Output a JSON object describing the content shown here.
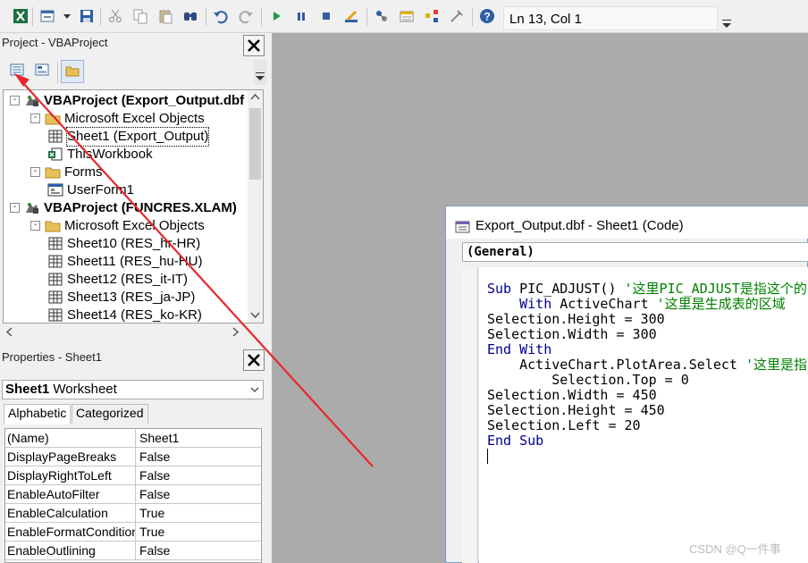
{
  "toolbar": {
    "position_text": "Ln 13, Col 1",
    "icons": [
      "excel-icon",
      "insert-userform-icon",
      "save-icon",
      "cut-icon",
      "copy-icon",
      "paste-icon",
      "find-icon",
      "undo-icon",
      "redo-icon",
      "run-icon",
      "break-icon",
      "reset-icon",
      "design-mode-icon",
      "project-explorer-icon",
      "properties-window-icon",
      "object-browser-icon",
      "toolbox-icon",
      "help-icon"
    ]
  },
  "project": {
    "title": "Project - VBAProject",
    "tree": [
      {
        "label": "VBAProject (Export_Output.dbf",
        "bold": true,
        "level": 0,
        "expander": "-",
        "icon": "vbaproject"
      },
      {
        "label": "Microsoft Excel Objects",
        "bold": false,
        "level": 1,
        "expander": "-",
        "icon": "folder"
      },
      {
        "label": "Sheet1 (Export_Output)",
        "bold": false,
        "level": 2,
        "expander": "",
        "icon": "sheet",
        "selected": true
      },
      {
        "label": "ThisWorkbook",
        "bold": false,
        "level": 2,
        "expander": "",
        "icon": "workbook"
      },
      {
        "label": "Forms",
        "bold": false,
        "level": 1,
        "expander": "-",
        "icon": "folder"
      },
      {
        "label": "UserForm1",
        "bold": false,
        "level": 2,
        "expander": "",
        "icon": "form"
      },
      {
        "label": "VBAProject (FUNCRES.XLAM)",
        "bold": true,
        "level": 0,
        "expander": "-",
        "icon": "vbaproject"
      },
      {
        "label": "Microsoft Excel Objects",
        "bold": false,
        "level": 1,
        "expander": "-",
        "icon": "folder"
      },
      {
        "label": "Sheet10 (RES_hr-HR)",
        "bold": false,
        "level": 2,
        "expander": "",
        "icon": "sheet"
      },
      {
        "label": "Sheet11 (RES_hu-HU)",
        "bold": false,
        "level": 2,
        "expander": "",
        "icon": "sheet"
      },
      {
        "label": "Sheet12 (RES_it-IT)",
        "bold": false,
        "level": 2,
        "expander": "",
        "icon": "sheet"
      },
      {
        "label": "Sheet13 (RES_ja-JP)",
        "bold": false,
        "level": 2,
        "expander": "",
        "icon": "sheet"
      },
      {
        "label": "Sheet14 (RES_ko-KR)",
        "bold": false,
        "level": 2,
        "expander": "",
        "icon": "sheet"
      }
    ]
  },
  "properties": {
    "title": "Properties - Sheet1",
    "object_name": "Sheet1",
    "object_type": "Worksheet",
    "tabs": [
      "Alphabetic",
      "Categorized"
    ],
    "rows": [
      {
        "name": "(Name)",
        "value": "Sheet1"
      },
      {
        "name": "DisplayPageBreaks",
        "value": "False"
      },
      {
        "name": "DisplayRightToLeft",
        "value": "False"
      },
      {
        "name": "EnableAutoFilter",
        "value": "False"
      },
      {
        "name": "EnableCalculation",
        "value": "True"
      },
      {
        "name": "EnableFormatConditionsCalculation",
        "value": "True"
      },
      {
        "name": "EnableOutlining",
        "value": "False"
      }
    ]
  },
  "code_window": {
    "title": "Export_Output.dbf - Sheet1 (Code)",
    "object_combo": "(General)",
    "lines": [
      [
        {
          "t": "Sub ",
          "k": "kw"
        },
        {
          "t": "PIC_ADJUST() ",
          "k": ""
        },
        {
          "t": "'这里PIC_ADJUST是指这个的",
          "k": "cm"
        }
      ],
      [
        {
          "t": "    With ",
          "k": "kw"
        },
        {
          "t": "ActiveChart ",
          "k": ""
        },
        {
          "t": "'这里是生成表的区域",
          "k": "cm"
        }
      ],
      [
        {
          "t": "Selection.Height = 300",
          "k": ""
        }
      ],
      [
        {
          "t": "Selection.Width = 300",
          "k": ""
        }
      ],
      [
        {
          "t": "End With",
          "k": "kw"
        }
      ],
      [
        {
          "t": "    ActiveChart.PlotArea.Select ",
          "k": ""
        },
        {
          "t": "'这里是指",
          "k": "cm"
        }
      ],
      [
        {
          "t": "        Selection.Top = 0",
          "k": ""
        }
      ],
      [
        {
          "t": "Selection.Width = 450",
          "k": ""
        }
      ],
      [
        {
          "t": "Selection.Height = 450",
          "k": ""
        }
      ],
      [
        {
          "t": "Selection.Left = 20",
          "k": ""
        }
      ],
      [
        {
          "t": "End Sub",
          "k": "kw"
        }
      ]
    ]
  },
  "watermark": "CSDN @Q一件事",
  "colors": {
    "keyword": "#00008b",
    "comment": "#008000",
    "annotation_arrow": "#e8262e"
  }
}
